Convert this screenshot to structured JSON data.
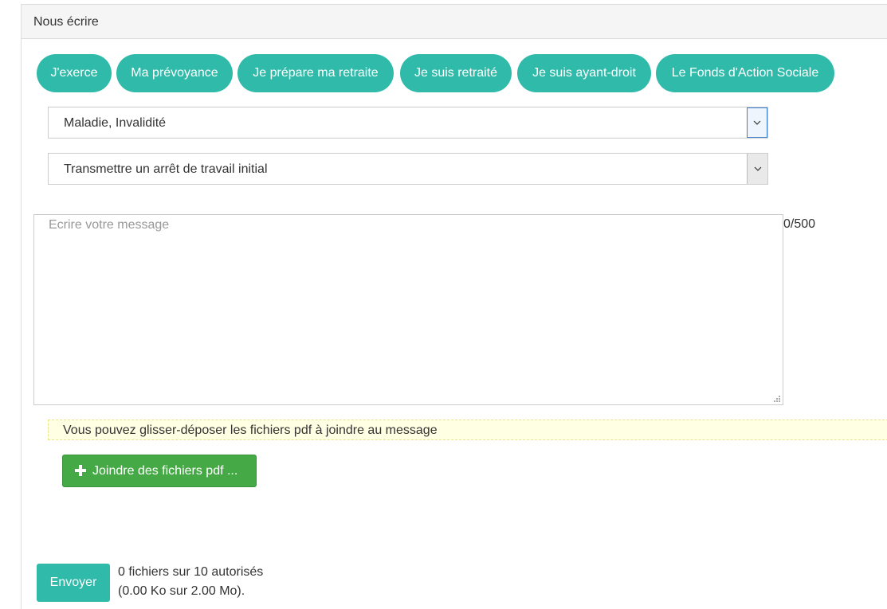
{
  "panel": {
    "title": "Nous écrire"
  },
  "categories": [
    {
      "label": "J'exerce"
    },
    {
      "label": "Ma prévoyance"
    },
    {
      "label": "Je prépare ma retraite"
    },
    {
      "label": "Je suis retraité"
    },
    {
      "label": "Je suis ayant-droit"
    },
    {
      "label": "Le Fonds d'Action Sociale"
    }
  ],
  "topic_select": {
    "value": "Maladie, Invalidité",
    "arrow_icon": "chevron-down-icon"
  },
  "subject_select": {
    "value": "Transmettre un arrêt de travail initial",
    "arrow_icon": "chevron-down-icon"
  },
  "message": {
    "placeholder": "Ecrire votre message",
    "value": "",
    "counter": "0/500"
  },
  "dropzone": {
    "text": "Vous pouvez glisser-déposer les fichiers pdf à joindre au message"
  },
  "attach_button": {
    "label": "Joindre des fichiers pdf ...",
    "icon": "plus-icon"
  },
  "send_button": {
    "label": "Envoyer"
  },
  "file_info": {
    "count_text": "0 fichiers sur 10 autorisés",
    "size_text": "(0.00 Ko sur 2.00 Mo)."
  },
  "colors": {
    "accent": "#2fbaa9",
    "success": "#45a945",
    "dropzone_bg": "#ffffe3",
    "panel_heading_bg": "#f5f5f5"
  }
}
